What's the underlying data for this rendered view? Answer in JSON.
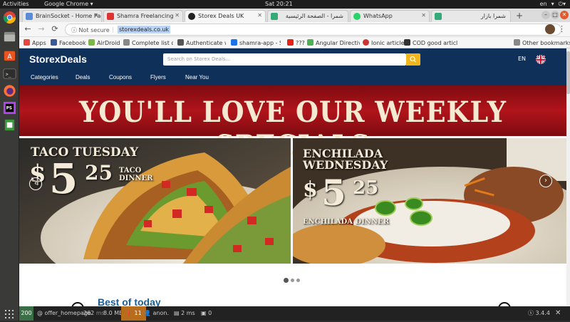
{
  "system": {
    "activities": "Activities",
    "app_menu": "Google Chrome",
    "clock": "Sat 20:21",
    "lang": "en"
  },
  "tabs": [
    {
      "label": "BrainSocket - Home Pag",
      "active": false,
      "fav_color": "#5a8bd6"
    },
    {
      "label": "Shamra Freelancing",
      "active": false,
      "fav_color": "#d33"
    },
    {
      "label": "Storex Deals UK",
      "active": true,
      "fav_color": "#222"
    },
    {
      "label": "شمرا - الصفحة الرئيسية",
      "active": false,
      "fav_color": "#3a7"
    },
    {
      "label": "WhatsApp",
      "active": false,
      "fav_color": "#25d366"
    },
    {
      "label": "شمرا بازار",
      "active": false,
      "fav_color": "#3a7"
    }
  ],
  "address": {
    "security": "Not secure",
    "url": "storexdeals.co.uk"
  },
  "bookmarks": [
    {
      "label": "Apps",
      "fav_color": "#e8453c"
    },
    {
      "label": "Facebook",
      "fav_color": "#3b5998"
    },
    {
      "label": "AirDroid",
      "fav_color": "#7ab648"
    },
    {
      "label": "Complete list of",
      "fav_color": "#888"
    },
    {
      "label": "Authenticate wi",
      "fav_color": "#555"
    },
    {
      "label": "shamra-app - Se",
      "fav_color": "#1a73e8"
    },
    {
      "label": "???",
      "fav_color": "#e62117"
    },
    {
      "label": "Angular Directiv",
      "fav_color": "#4caf50"
    },
    {
      "label": "Ionic article",
      "fav_color": "#c33"
    },
    {
      "label": "COD good articl",
      "fav_color": "#333"
    }
  ],
  "other_bookmarks": "Other bookmarks",
  "site": {
    "logo": "StorexDeals",
    "search_placeholder": "Search on Storex Deals...",
    "language": "EN",
    "nav": [
      "Categories",
      "Deals",
      "Coupons",
      "Flyers",
      "Near You"
    ],
    "banner_headline": "YOU'LL LOVE OUR WEEKLY SPECIALS",
    "promos": [
      {
        "line1": "TACO TUESDAY",
        "dollar": "$",
        "price": "5",
        "cents": "25",
        "sub1": "TACO",
        "sub2": "DINNER"
      },
      {
        "line1": "ENCHILADA",
        "line2": "WEDNESDAY",
        "dollar": "$",
        "price": "5",
        "cents": "25",
        "sub1": "ENCHILADA DINNER"
      }
    ],
    "section_title": "Best of today"
  },
  "debug": {
    "status": "200",
    "route": "@ offer_homepage",
    "time": "262",
    "time_unit": "ms",
    "memory": "8.0 MB",
    "warnings": "11",
    "user": "anon.",
    "db_time": "2",
    "db_unit": "ms",
    "twig": "0",
    "version": "3.4.4"
  },
  "colors": {
    "header_bg": "#0f3059",
    "banner_red": "#b1141b",
    "search_button": "#f2b51c",
    "section_title": "#1d5c92"
  }
}
